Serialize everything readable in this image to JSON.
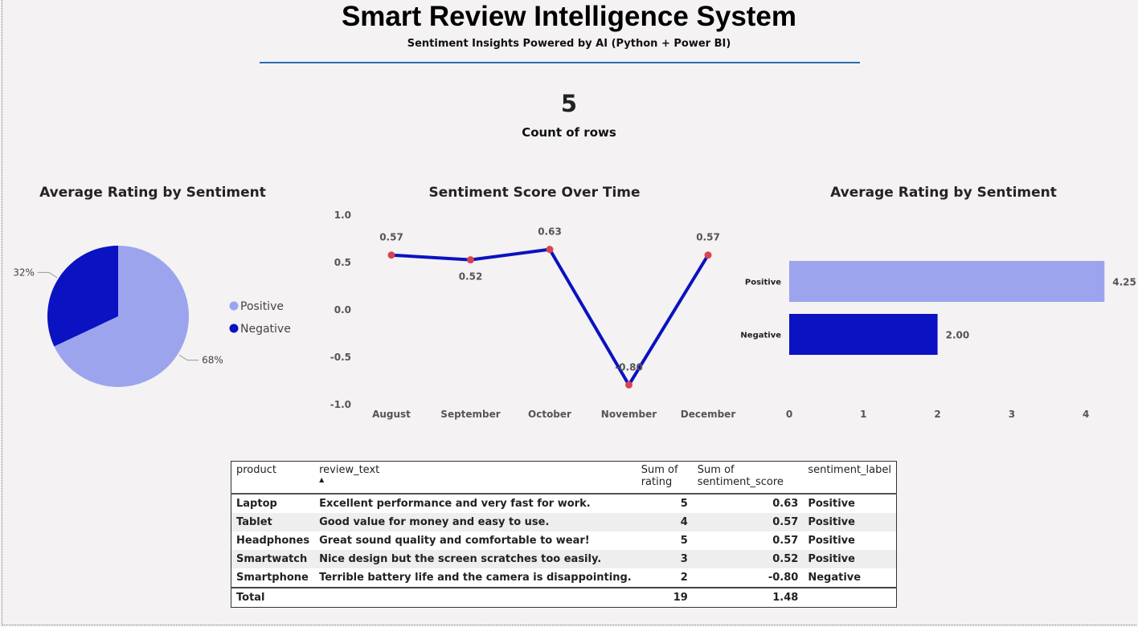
{
  "header": {
    "title": "Smart Review Intelligence System",
    "subtitle": "Sentiment Insights Powered by AI (Python + Power BI)"
  },
  "kpi": {
    "value": "5",
    "label": "Count of rows"
  },
  "colors": {
    "positive": "#9ca4ee",
    "negative": "#0a12c1",
    "line": "#0a12c1",
    "marker": "#d8434f",
    "rule": "#2a6fb0"
  },
  "pie_title": "Average Rating by Sentiment",
  "line_title": "Sentiment Score Over Time",
  "bar_title": "Average Rating by Sentiment",
  "chart_data": [
    {
      "type": "pie",
      "title": "Average Rating by Sentiment",
      "categories": [
        "Positive",
        "Negative"
      ],
      "values": [
        68,
        32
      ],
      "labels": [
        "68%",
        "32%"
      ],
      "legend_position": "right"
    },
    {
      "type": "line",
      "title": "Sentiment Score Over Time",
      "x": [
        "August",
        "September",
        "October",
        "November",
        "December"
      ],
      "y": [
        0.57,
        0.52,
        0.63,
        -0.8,
        0.57
      ],
      "data_labels": [
        "0.57",
        "0.52",
        "0.63",
        "-0.80",
        "0.57"
      ],
      "ylim": [
        -1.0,
        1.0
      ],
      "yticks": [
        "1.0",
        "0.5",
        "0.0",
        "-0.5",
        "-1.0"
      ]
    },
    {
      "type": "bar",
      "orientation": "horizontal",
      "title": "Average Rating by Sentiment",
      "categories": [
        "Positive",
        "Negative"
      ],
      "values": [
        4.25,
        2.0
      ],
      "data_labels": [
        "4.25",
        "2.00"
      ],
      "xlim": [
        0,
        4.3
      ],
      "xticks": [
        "0",
        "1",
        "2",
        "3",
        "4"
      ]
    }
  ],
  "table": {
    "columns": [
      "product",
      "review_text",
      "Sum of rating",
      "Sum of sentiment_score",
      "sentiment_label"
    ],
    "rows": [
      [
        "Laptop",
        "Excellent performance and very fast for work.",
        "5",
        "0.63",
        "Positive"
      ],
      [
        "Tablet",
        "Good value for money and easy to use.",
        "4",
        "0.57",
        "Positive"
      ],
      [
        "Headphones",
        "Great sound quality and comfortable to wear!",
        "5",
        "0.57",
        "Positive"
      ],
      [
        "Smartwatch",
        "Nice design but the screen scratches too easily.",
        "3",
        "0.52",
        "Positive"
      ],
      [
        "Smartphone",
        "Terrible battery life and the camera is disappointing.",
        "2",
        "-0.80",
        "Negative"
      ]
    ],
    "total": [
      "Total",
      "",
      "19",
      "1.48",
      ""
    ],
    "sort_indicator": "▲"
  }
}
